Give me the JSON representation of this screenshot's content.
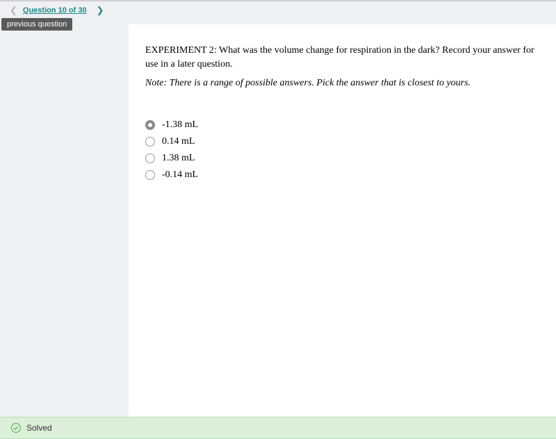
{
  "nav": {
    "counter": "Question 10 of 30",
    "tooltip": "previous question"
  },
  "question": {
    "text": "EXPERIMENT 2: What was the volume change for respiration in the dark? Record your answer for use in a later question.",
    "note": "Note: There is a range of possible answers. Pick the answer that is closest to yours."
  },
  "options": [
    {
      "label": "-1.38 mL",
      "selected": true
    },
    {
      "label": "0.14 mL",
      "selected": false
    },
    {
      "label": "1.38 mL",
      "selected": false
    },
    {
      "label": "-0.14 mL",
      "selected": false
    }
  ],
  "footer": {
    "status": "Solved"
  }
}
